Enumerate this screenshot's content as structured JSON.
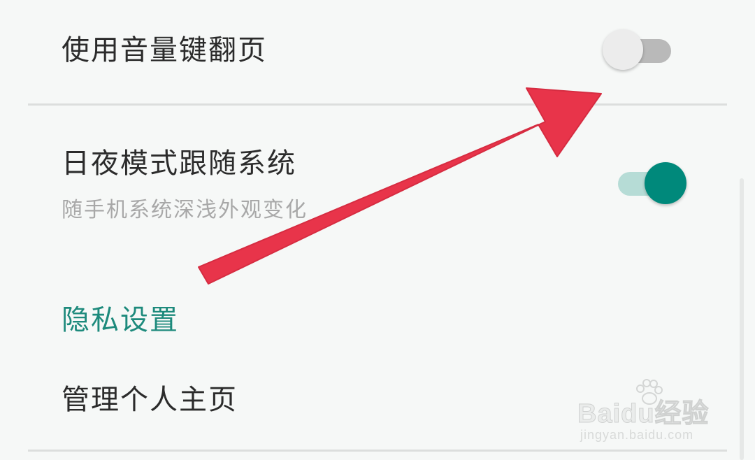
{
  "settings": {
    "volume_page_turn": {
      "title": "使用音量键翻页",
      "enabled": false
    },
    "follow_system_theme": {
      "title": "日夜模式跟随系统",
      "subtitle": "随手机系统深浅外观变化",
      "enabled": true
    },
    "privacy_section": {
      "header": "隐私设置"
    },
    "manage_profile": {
      "title": "管理个人主页"
    }
  },
  "overlay": {
    "annotation": "red-arrow-pointing-to-toggle"
  },
  "watermark": {
    "brand": "Baidu经验",
    "url": "jingyan.baidu.com"
  },
  "colors": {
    "accent": "#00897b",
    "section_header": "#1d8a7c",
    "arrow": "#e8344a",
    "background": "#f6f8f7"
  }
}
